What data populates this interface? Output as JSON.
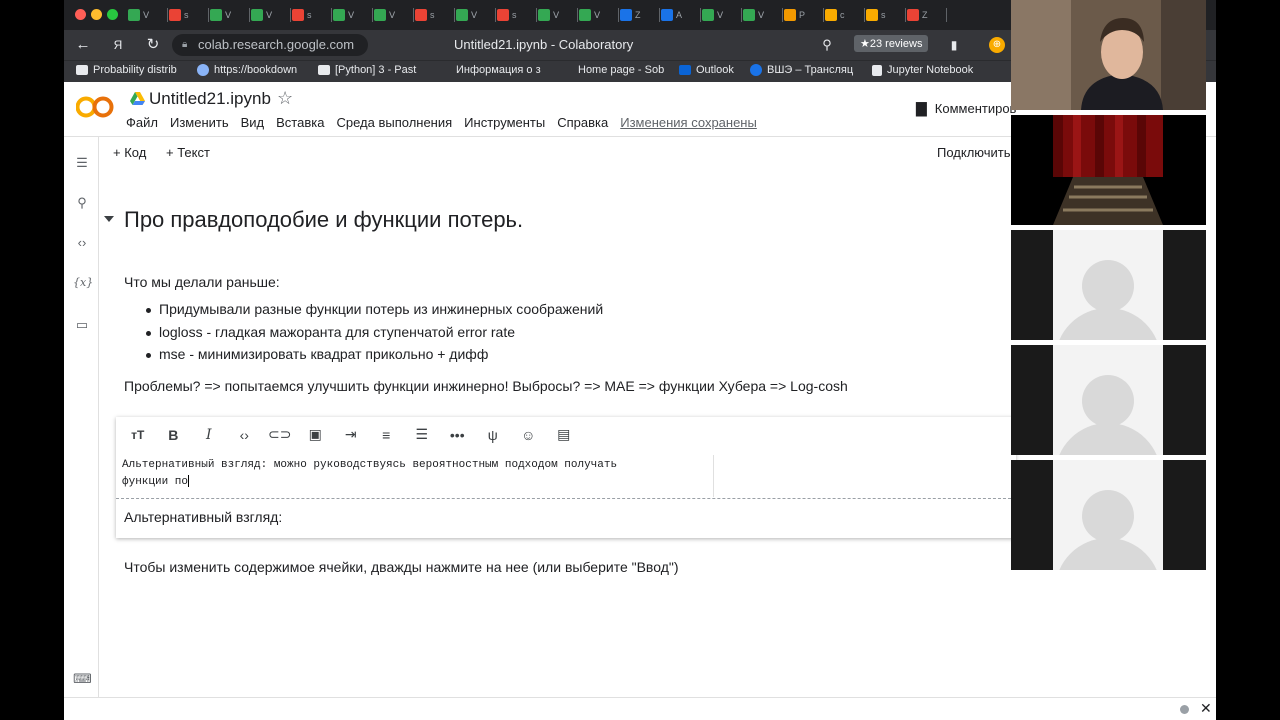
{
  "browser": {
    "url": "colab.research.google.com",
    "page_title": "Untitled21.ipynb - Colaboratory",
    "reviews_badge": "★23 reviews",
    "tabs": [
      "ᐯ",
      "s",
      "ᐯ",
      "ᐯ",
      "s",
      "ᐯ",
      "ᐯ",
      "s",
      "ᐯ",
      "s",
      "ᐯ",
      "ᐯ",
      "Z",
      "A",
      "ᐯ",
      "ᐯ",
      "P",
      "c",
      "s",
      "Z"
    ],
    "bookmarks": [
      "Probability distrib",
      "https://bookdown",
      "[Python] 3 - Past",
      "Информация о з",
      "Home page - Sob",
      "Outlook",
      "ВШЭ – Трансляц",
      "Jupyter Notebook"
    ]
  },
  "colab": {
    "notebook_title": "Untitled21.ipynb",
    "logo_text": "CO",
    "menu": [
      "Файл",
      "Изменить",
      "Вид",
      "Вставка",
      "Среда выполнения",
      "Инструменты",
      "Справка"
    ],
    "saved_status": "Изменения сохранены",
    "comment_label": "Комментиров",
    "add_code": "+ Код",
    "add_text": "+ Текст",
    "connect_label": "Подключиться"
  },
  "content": {
    "heading": "Про правдоподобие и функции потерь.",
    "intro": "Что мы делали раньше:",
    "bullets": [
      "Придумывали разные функции потерь из инжинерных соображений",
      "logloss - гладкая мажоранта для ступенчатой error rate",
      "mse - минимизировать квадрат прикольно + дифф"
    ],
    "problems": "Проблемы? => попытаемся улучшить функции инжинерно! Выбросы? => MAE => функции Хубера => Log-cosh",
    "editor_line1": "Альтернативный взгляд: можно руководствуясь вероятностным подходом получать",
    "editor_line2": "функции по",
    "preview": "Альтернативный взгляд:",
    "hint": "Чтобы изменить содержимое ячейки, дважды нажмите на нее (или выберите \"Ввод\")"
  },
  "colors": {
    "colab_orange": "#f9ab00",
    "chrome_dark": "#202124",
    "chrome_mid": "#35363a"
  }
}
